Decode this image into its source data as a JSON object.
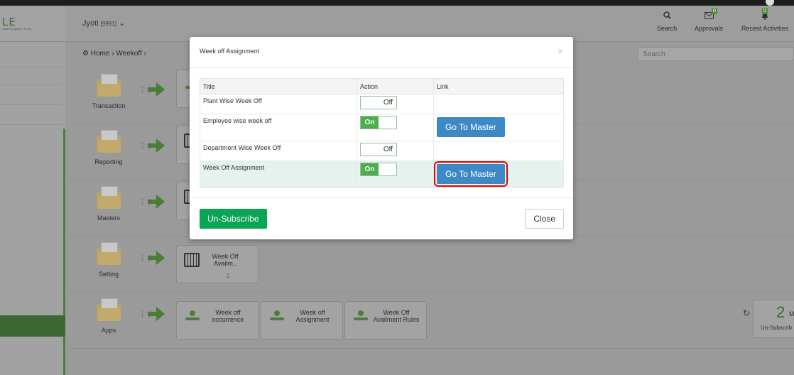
{
  "header": {
    "logo_text": "LE",
    "logo_tagline": "Smart Employee Portal",
    "user_name": "Jyoti",
    "user_code": "[9991]",
    "search_label": "Search",
    "approvals_label": "Approvals",
    "approvals_badge": "0",
    "activities_label": "Recent Activities",
    "activities_badge": "0"
  },
  "breadcrumb": {
    "home": "Home",
    "current": "Weekoff",
    "sep": "›"
  },
  "search": {
    "placeholder": "Search"
  },
  "rows": [
    {
      "label": "Transaction"
    },
    {
      "label": "Reporting"
    },
    {
      "label": "Masters"
    },
    {
      "label": "Setting",
      "tiles": [
        {
          "title": "Week Off Availm..",
          "count": "2"
        }
      ]
    },
    {
      "label": "Apps",
      "tiles": [
        {
          "title": "Week off occurrence"
        },
        {
          "title": "Week off Assignment"
        },
        {
          "title": "Week Off Availment Rules"
        }
      ]
    }
  ],
  "summary": {
    "count": "2",
    "unit": "M",
    "label": "Un-Subscrib"
  },
  "modal": {
    "title": "Week off Assignment",
    "close_glyph": "×",
    "columns": [
      "Title",
      "Action",
      "Link"
    ],
    "rows": [
      {
        "title": "Plant Wise Week Off",
        "state": "Off",
        "link": ""
      },
      {
        "title": "Employee wise week off",
        "state": "On",
        "link": "Go To Master"
      },
      {
        "title": "Department Wise Week Off",
        "state": "Off",
        "link": ""
      },
      {
        "title": "Week Off Assignment",
        "state": "On",
        "link": "Go To Master"
      }
    ],
    "unsubscribe_label": "Un-Subscribe",
    "close_label": "Close"
  },
  "colors": {
    "accent_green": "#4cae4c",
    "primary_blue": "#3d89c5",
    "unsubscribe_green": "#09a454",
    "focus_red": "#e00000"
  }
}
